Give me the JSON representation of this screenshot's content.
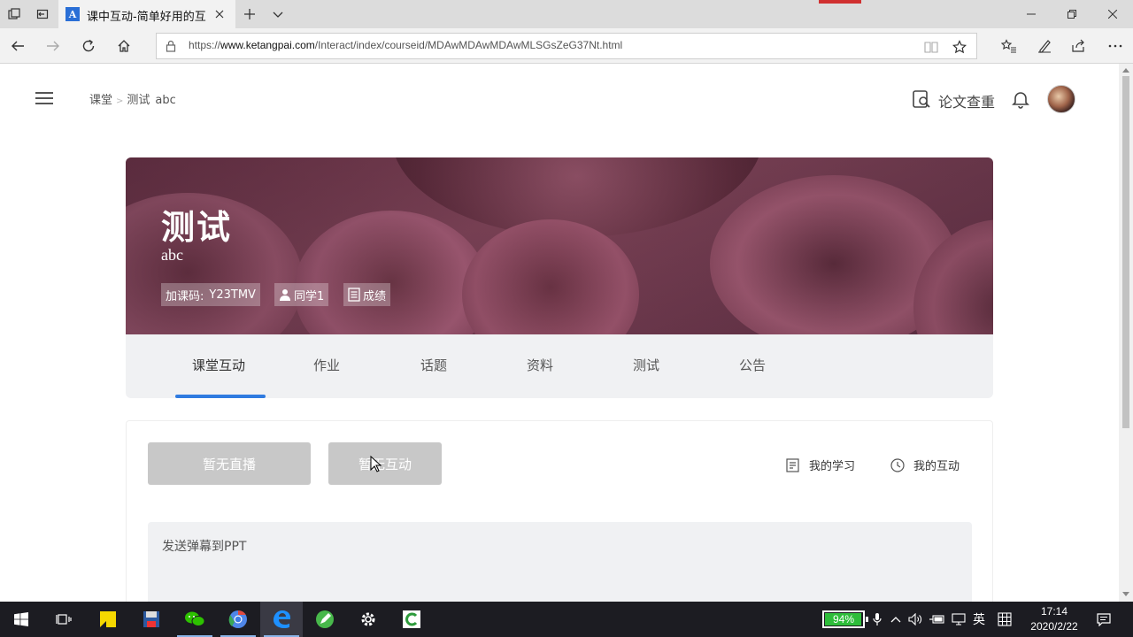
{
  "browser": {
    "tab_title": "课中互动-简单好用的互",
    "url_prefix": "https://",
    "url_host": "www.ketangpai.com",
    "url_path": "/Interact/index/courseid/MDAwMDAwMDAwMLSGsZeG37Nt.html"
  },
  "header": {
    "breadcrumb": [
      "课堂",
      "测试",
      "abc"
    ],
    "plagiarism_label": "论文查重"
  },
  "course": {
    "title": "测试",
    "subtitle": "abc",
    "join_code_label": "加课码:",
    "join_code": "Y23TMV",
    "members_label": "同学1",
    "grades_label": "成绩"
  },
  "tabs": [
    "课堂互动",
    "作业",
    "话题",
    "资料",
    "测试",
    "公告"
  ],
  "active_tab": 0,
  "interaction": {
    "live_button": "暂无直播",
    "interact_button": "暂无互动",
    "my_study": "我的学习",
    "my_interaction": "我的互动",
    "danmaku_placeholder": "发送弹幕到PPT"
  },
  "taskbar": {
    "battery_percent": "94%",
    "battery_level": 0.94,
    "ime": "英",
    "time": "17:14",
    "date": "2020/2/22"
  },
  "colors": {
    "accent": "#2f7be0",
    "banner": "#6b3347",
    "disabled_button": "#c8c8c8"
  }
}
